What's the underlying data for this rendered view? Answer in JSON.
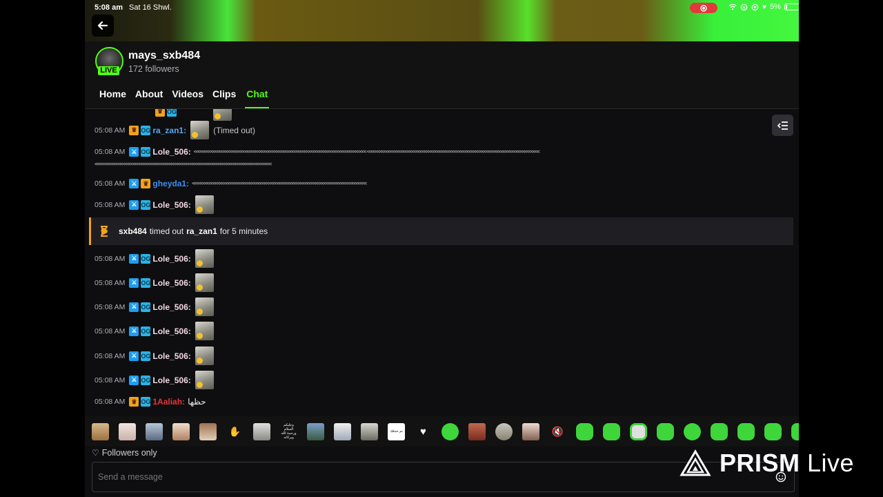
{
  "status_bar": {
    "time": "5:08 am",
    "date": "Sat 16 Shwl.",
    "battery": "5%"
  },
  "channel": {
    "name": "mays_sxb484",
    "followers": "172 followers",
    "live_label": "LIVE"
  },
  "tabs": [
    {
      "label": "Home",
      "active": false
    },
    {
      "label": "About",
      "active": false
    },
    {
      "label": "Videos",
      "active": false
    },
    {
      "label": "Clips",
      "active": false
    },
    {
      "label": "Chat",
      "active": true
    }
  ],
  "chat": {
    "messages": [
      {
        "time": "05:08 AM",
        "user": "ra_zan1:",
        "user_color": "#59a7f0",
        "note": "(Timed out)"
      },
      {
        "time": "05:08 AM",
        "user": "Lole_506:",
        "user_color": "#f2d9e6"
      },
      {
        "time": "05:08 AM",
        "user": "gheyda1:",
        "user_color": "#3a8ef0"
      },
      {
        "time": "05:08 AM",
        "user": "Lole_506:",
        "user_color": "#f2d9e6"
      },
      {
        "time": "05:08 AM",
        "user": "Lole_506:",
        "user_color": "#f2d9e6"
      },
      {
        "time": "05:08 AM",
        "user": "Lole_506:",
        "user_color": "#f2d9e6"
      },
      {
        "time": "05:08 AM",
        "user": "Lole_506:",
        "user_color": "#f2d9e6"
      },
      {
        "time": "05:08 AM",
        "user": "Lole_506:",
        "user_color": "#f2d9e6"
      },
      {
        "time": "05:08 AM",
        "user": "Lole_506:",
        "user_color": "#f2d9e6"
      },
      {
        "time": "05:08 AM",
        "user": "Lole_506:",
        "user_color": "#f2d9e6"
      },
      {
        "time": "05:08 AM",
        "user": "1Aaliah:",
        "user_color": "#e8343a",
        "text": "حظها"
      }
    ],
    "notice": {
      "actor": "sxb484",
      "action": "timed out",
      "target": "ra_zan1",
      "duration": "for 5 minutes"
    }
  },
  "emote_tile_texts": [
    "وعليكم السلام ورحمة الله وبركاته",
    "تم حذفك"
  ],
  "followers_only": "Followers only",
  "input": {
    "placeholder": "Send a message"
  },
  "watermark": {
    "brand": "PRISM",
    "suffix": "Live"
  },
  "colors": {
    "accent": "#53fc18",
    "notice_border": "#f2a21b"
  }
}
